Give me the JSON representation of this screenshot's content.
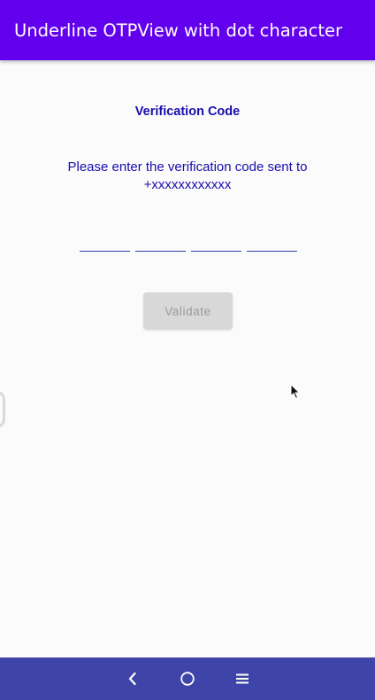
{
  "app_bar": {
    "title": "Underline OTPView with dot character"
  },
  "verification": {
    "heading": "Verification Code",
    "instruction": "Please enter the verification code sent to +xxxxxxxxxxxx",
    "otp_boxes": [
      "",
      "",
      "",
      ""
    ],
    "validate_label": "Validate",
    "validate_enabled": false
  },
  "nav_bar": {
    "back_icon": "chevron-left-icon",
    "home_icon": "circle-home-icon",
    "menu_icon": "hamburger-menu-icon"
  },
  "colors": {
    "app_bar": "#6200ee",
    "accent_text": "#1a0dab",
    "underline": "#2b3fa8",
    "nav_bar": "#3f45a8",
    "button_disabled_bg": "#d8d8d8",
    "button_disabled_text": "#9a9a9a"
  }
}
